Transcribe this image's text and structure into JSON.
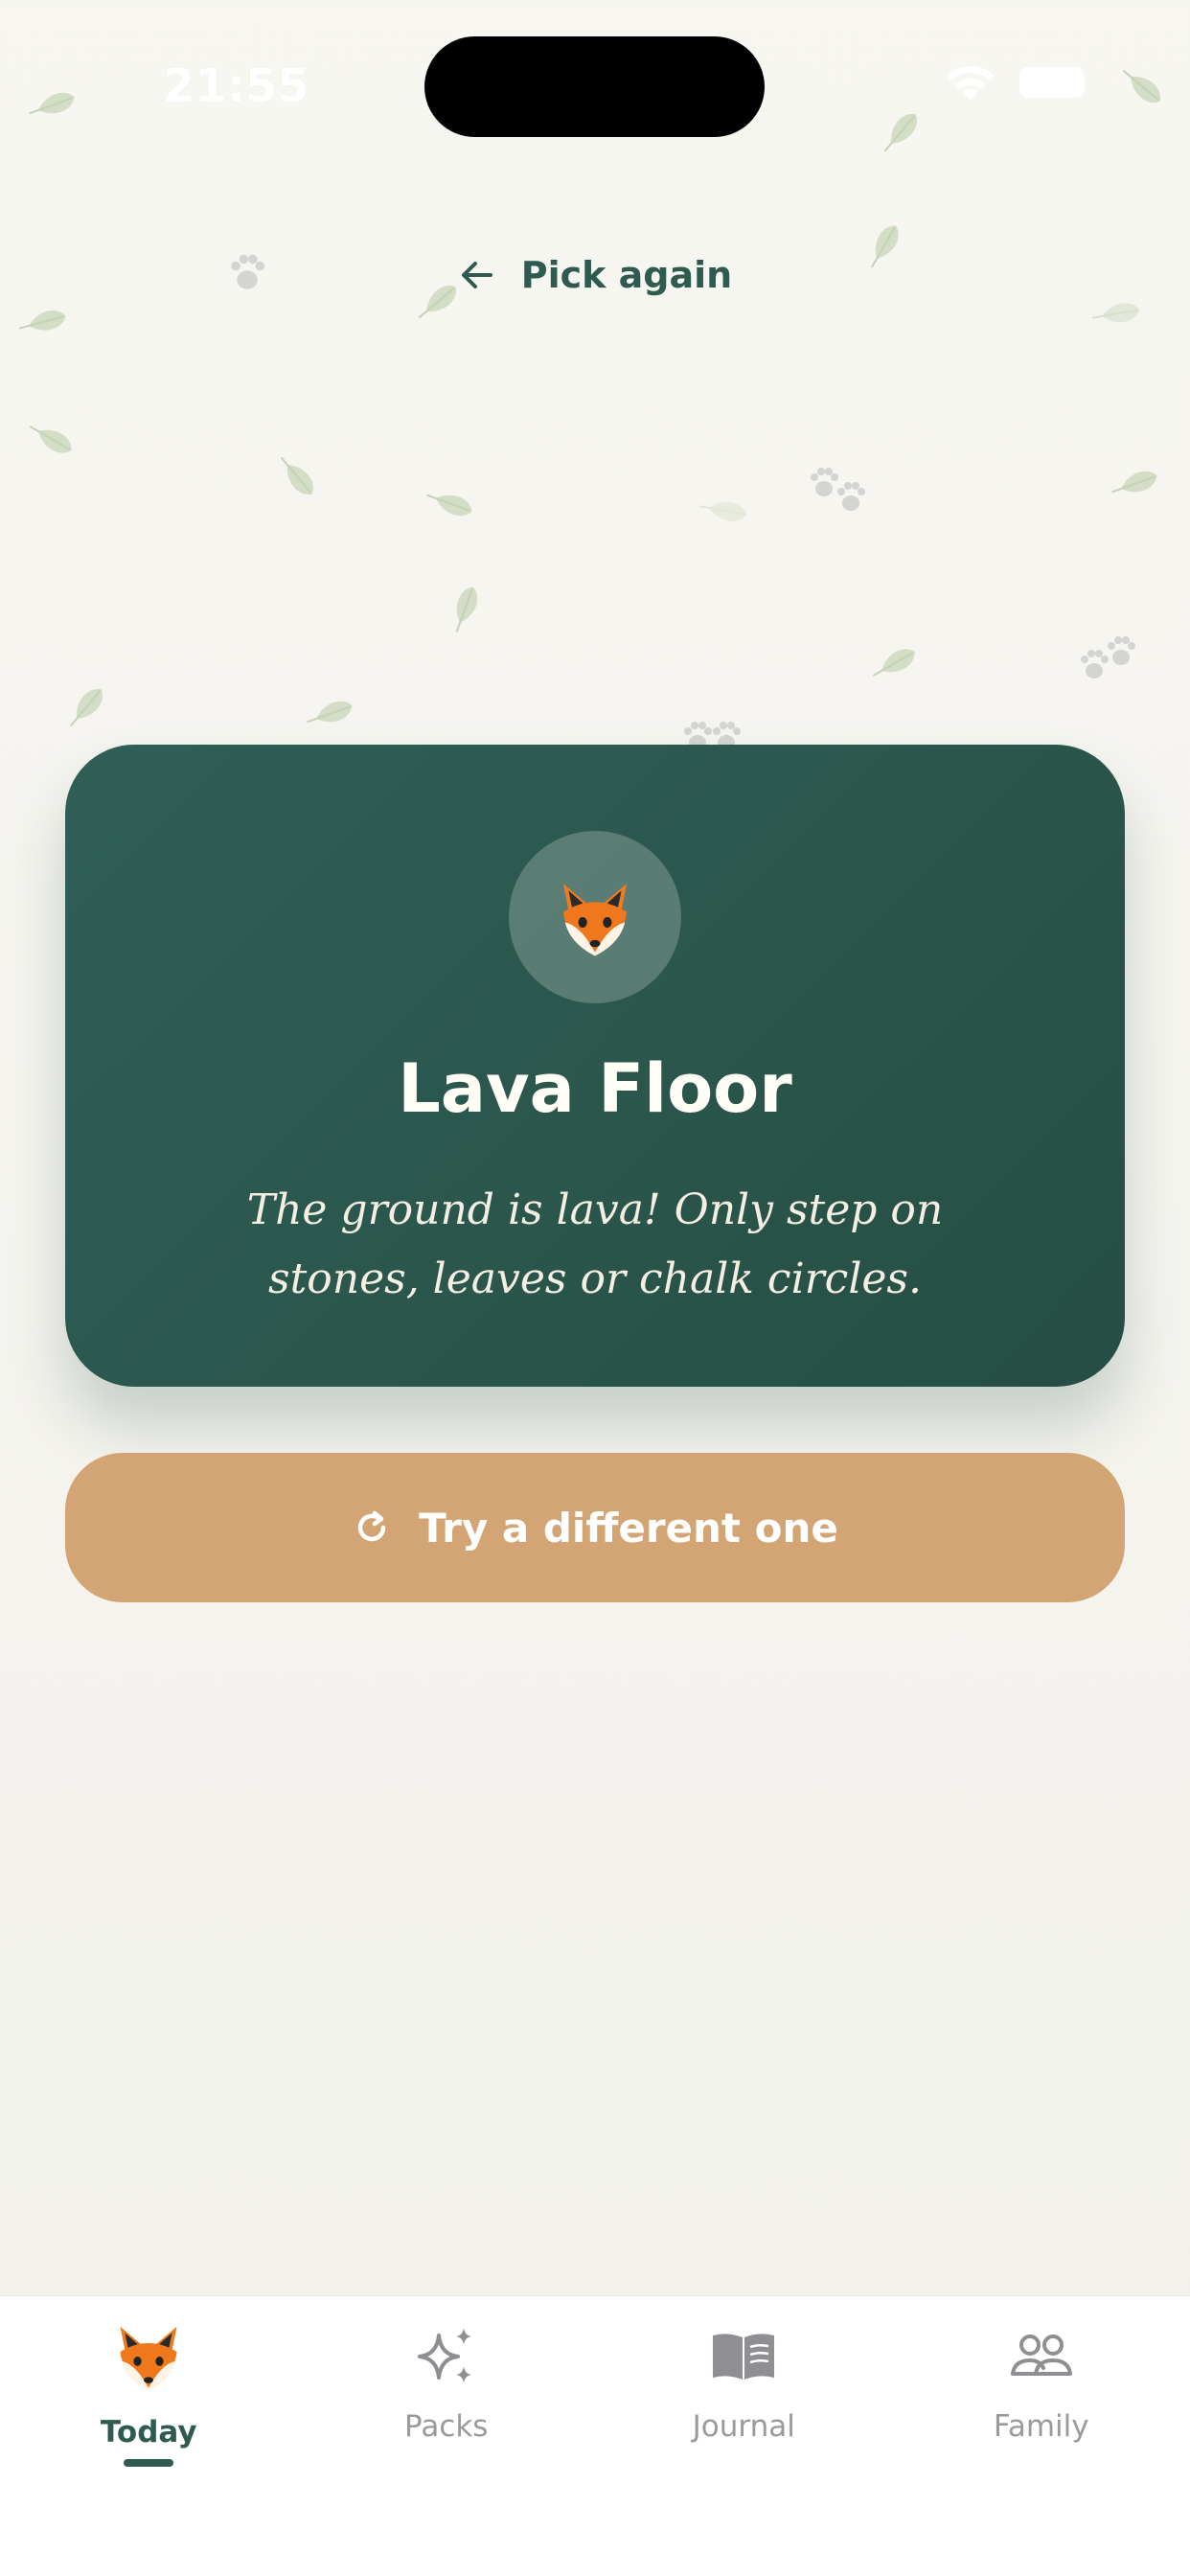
{
  "status_bar": {
    "time": "21:55"
  },
  "header": {
    "back_label": "Pick again",
    "back_icon": "arrow-left-icon"
  },
  "activity": {
    "icon": "fox-icon",
    "title": "Lava Floor",
    "description": "The ground is lava! Only step on stones, leaves or chalk circles."
  },
  "cta": {
    "label": "Try a different one",
    "icon": "refresh-icon"
  },
  "tabbar": {
    "active_index": 0,
    "tabs": [
      {
        "label": "Today",
        "icon": "fox-icon"
      },
      {
        "label": "Packs",
        "icon": "sparkles-icon"
      },
      {
        "label": "Journal",
        "icon": "book-icon"
      },
      {
        "label": "Family",
        "icon": "people-icon"
      }
    ]
  },
  "colors": {
    "primary": "#2e5a50",
    "card": "#2a554b",
    "accent": "#d4a574",
    "background": "#f5f4ef"
  }
}
